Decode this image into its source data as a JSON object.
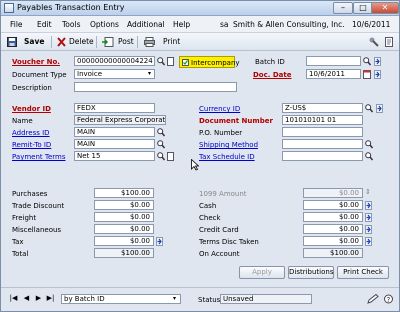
{
  "window": {
    "title": "Payables Transaction Entry"
  },
  "menu": {
    "items": [
      "File",
      "Edit",
      "Tools",
      "Options",
      "Additional",
      "Help"
    ],
    "user": "sa",
    "company": "Smith & Allen Consulting, Inc.",
    "date": "10/6/2011"
  },
  "toolbar": {
    "save": "Save",
    "delete": "Delete",
    "post": "Post",
    "print": "Print"
  },
  "header": {
    "voucher_label": "Voucher No.",
    "voucher_value": "00000000000004224",
    "intercompany_label": "Intercompany",
    "batch_label": "Batch ID",
    "batch_value": "",
    "doctype_label": "Document Type",
    "doctype_value": "Invoice",
    "docdate_label": "Doc. Date",
    "docdate_value": "10/6/2011",
    "description_label": "Description",
    "description_value": ""
  },
  "vendor": {
    "vendor_label": "Vendor ID",
    "vendor_value": "FEDX",
    "name_label": "Name",
    "name_value": "Federal Express Corporation",
    "address_label": "Address ID",
    "address_value": "MAIN",
    "remit_label": "Remit-To ID",
    "remit_value": "MAIN",
    "terms_label": "Payment Terms",
    "terms_value": "Net 15",
    "currency_label": "Currency ID",
    "currency_value": "Z-US$",
    "docnum_label": "Document Number",
    "docnum_value": "101010101 01",
    "po_label": "P.O. Number",
    "po_value": "",
    "ship_label": "Shipping Method",
    "ship_value": "",
    "tax_label": "Tax Schedule ID",
    "tax_value": ""
  },
  "amounts_left": [
    {
      "label": "Purchases",
      "value": "$100.00"
    },
    {
      "label": "Trade Discount",
      "value": "$0.00"
    },
    {
      "label": "Freight",
      "value": "$0.00"
    },
    {
      "label": "Miscellaneous",
      "value": "$0.00"
    },
    {
      "label": "Tax",
      "value": "$0.00"
    },
    {
      "label": "Total",
      "value": "$100.00"
    }
  ],
  "amounts_right": [
    {
      "label": "1099 Amount",
      "value": "$0.00"
    },
    {
      "label": "Cash",
      "value": "$0.00"
    },
    {
      "label": "Check",
      "value": "$0.00"
    },
    {
      "label": "Credit Card",
      "value": "$0.00"
    },
    {
      "label": "Terms Disc Taken",
      "value": "$0.00"
    },
    {
      "label": "On Account",
      "value": "$100.00"
    }
  ],
  "buttons": {
    "apply": "Apply",
    "distributions": "Distributions",
    "print_check": "Print Check"
  },
  "statusbar": {
    "sort": "by Batch ID",
    "status_label": "Status",
    "status_value": "Unsaved"
  }
}
